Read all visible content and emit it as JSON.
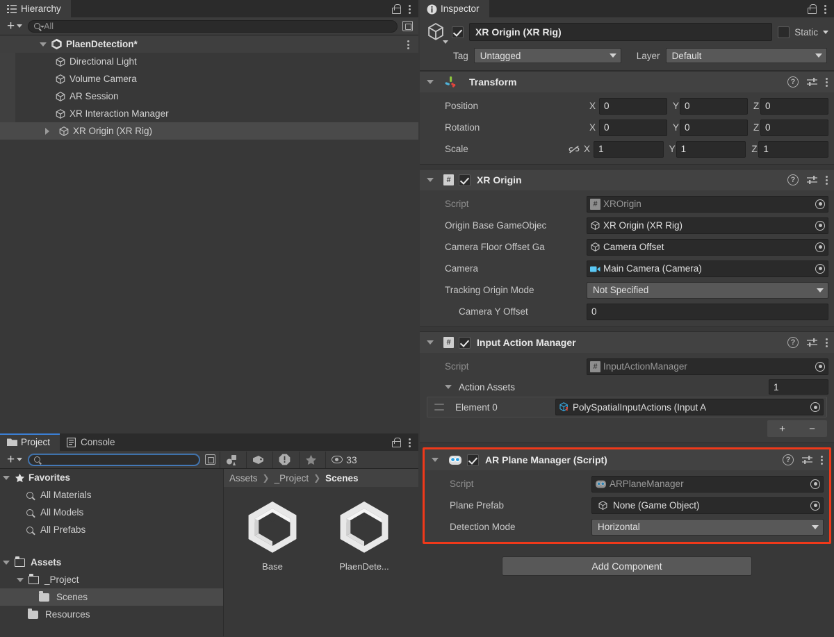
{
  "hierarchy": {
    "tab_label": "Hierarchy",
    "tab_icon": "hierarchy-icon",
    "search_placeholder": "All",
    "search_value": "",
    "scene": {
      "label": "PlaenDetection*",
      "icon": "unity-scene-icon"
    },
    "items": [
      {
        "label": "Directional Light",
        "icon": "gameobject-cube-icon",
        "selected": false,
        "expandable": false
      },
      {
        "label": "Volume Camera",
        "icon": "gameobject-cube-icon",
        "selected": false,
        "expandable": false
      },
      {
        "label": "AR Session",
        "icon": "gameobject-cube-icon",
        "selected": false,
        "expandable": false
      },
      {
        "label": "XR Interaction Manager",
        "icon": "gameobject-cube-icon",
        "selected": false,
        "expandable": false
      },
      {
        "label": "XR Origin (XR Rig)",
        "icon": "gameobject-cube-icon",
        "selected": true,
        "expandable": true
      }
    ]
  },
  "project": {
    "tabs": [
      {
        "label": "Project",
        "icon": "folder-icon",
        "active": true
      },
      {
        "label": "Console",
        "icon": "console-icon",
        "active": false
      }
    ],
    "search_value": "",
    "search_placeholder": "",
    "filter_icons": [
      "asset-type-filter-icon",
      "label-filter-icon",
      "warning-filter-icon",
      "favorite-filter-icon"
    ],
    "visible_count": "33",
    "tree": [
      {
        "label": "Favorites",
        "icon": "star-icon",
        "depth": 0,
        "expanded": true,
        "bold": true,
        "selected": false
      },
      {
        "label": "All Materials",
        "icon": "search-icon",
        "depth": 1,
        "bold": false,
        "selected": false
      },
      {
        "label": "All Models",
        "icon": "search-icon",
        "depth": 1,
        "bold": false,
        "selected": false
      },
      {
        "label": "All Prefabs",
        "icon": "search-icon",
        "depth": 1,
        "bold": false,
        "selected": false
      },
      {
        "label": "",
        "icon": "spacer",
        "depth": 0,
        "bold": false,
        "selected": false
      },
      {
        "label": "Assets",
        "icon": "folder-open-icon",
        "depth": 0,
        "expanded": true,
        "bold": true,
        "selected": false
      },
      {
        "label": "_Project",
        "icon": "folder-open-icon",
        "depth": 1,
        "expanded": true,
        "bold": false,
        "selected": false
      },
      {
        "label": "Scenes",
        "icon": "folder-icon",
        "depth": 2,
        "bold": false,
        "selected": true
      },
      {
        "label": "Resources",
        "icon": "folder-icon",
        "depth": 1,
        "bold": false,
        "selected": false
      }
    ],
    "breadcrumbs": [
      "Assets",
      "_Project",
      "Scenes"
    ],
    "assets": [
      {
        "label": "Base",
        "icon": "unity-scene-asset-icon"
      },
      {
        "label": "PlaenDete...",
        "icon": "unity-scene-asset-icon"
      }
    ]
  },
  "inspector": {
    "tab_label": "Inspector",
    "tab_icon": "info-icon",
    "object": {
      "enabled": true,
      "name": "XR Origin (XR Rig)",
      "static_label": "Static",
      "static_checked": false,
      "tag_label": "Tag",
      "tag_value": "Untagged",
      "layer_label": "Layer",
      "layer_value": "Default"
    },
    "components": [
      {
        "title": "Transform",
        "icon": "transform-axis-icon",
        "has_checkbox": false,
        "expanded": true,
        "highlight": false,
        "vectors": [
          {
            "label": "Position",
            "x": "0",
            "y": "0",
            "z": "0",
            "link": false
          },
          {
            "label": "Rotation",
            "x": "0",
            "y": "0",
            "z": "0",
            "link": false
          },
          {
            "label": "Scale",
            "x": "1",
            "y": "1",
            "z": "1",
            "link": true
          }
        ],
        "axis_labels": [
          "X",
          "Y",
          "Z"
        ]
      },
      {
        "title": "XR Origin",
        "icon": "cs-script-icon",
        "has_checkbox": true,
        "checked": true,
        "expanded": true,
        "highlight": false,
        "fields": [
          {
            "label": "Script",
            "type": "object",
            "value": "XROrigin",
            "value_icon": "cs-script-icon",
            "dim": true
          },
          {
            "label": "Origin Base GameObjec",
            "type": "object",
            "value": "XR Origin (XR Rig)",
            "value_icon": "gameobject-cube-icon",
            "dim": false
          },
          {
            "label": "Camera Floor Offset Ga",
            "type": "object",
            "value": "Camera Offset",
            "value_icon": "gameobject-cube-icon",
            "dim": false
          },
          {
            "label": "Camera",
            "type": "object",
            "value": "Main Camera (Camera)",
            "value_icon": "camera-icon",
            "dim": false
          },
          {
            "label": "Tracking Origin Mode",
            "type": "dropdown",
            "value": "Not Specified",
            "dim": false
          },
          {
            "label": "Camera Y Offset",
            "type": "number",
            "value": "0",
            "indent": true,
            "dim": false
          }
        ]
      },
      {
        "title": "Input Action Manager",
        "icon": "cs-script-icon",
        "has_checkbox": true,
        "checked": true,
        "expanded": true,
        "highlight": false,
        "fields": [
          {
            "label": "Script",
            "type": "object",
            "value": "InputActionManager",
            "value_icon": "cs-script-icon",
            "dim": true
          }
        ],
        "array": {
          "label": "Action Assets",
          "count": "1",
          "elements": [
            {
              "label": "Element 0",
              "value": "PolySpatialInputActions (Input A",
              "value_icon": "input-actions-asset-icon"
            }
          ],
          "add_label": "+",
          "remove_label": "−"
        }
      },
      {
        "title": "AR Plane Manager (Script)",
        "icon": "ar-plane-manager-icon",
        "has_checkbox": true,
        "checked": true,
        "expanded": true,
        "highlight": true,
        "highlight_color": "#f0391a",
        "fields": [
          {
            "label": "Script",
            "type": "object",
            "value": "ARPlaneManager",
            "value_icon": "ar-plane-manager-icon",
            "dim": true
          },
          {
            "label": "Plane Prefab",
            "type": "object",
            "value": "None (Game Object)",
            "value_icon": "gameobject-cube-icon",
            "dim": false
          },
          {
            "label": "Detection Mode",
            "type": "dropdown",
            "value": "Horizontal",
            "dim": false
          }
        ]
      }
    ],
    "add_component_label": "Add Component"
  },
  "colors": {
    "window_bg": "#383838",
    "tabbar_bg": "#2b2b2b",
    "panel_bg": "#3c3c3c",
    "comp_header_bg": "#424242",
    "field_bg": "#2a2a2a",
    "dropdown_bg": "#585858",
    "selection": "#4a4a4a",
    "accent_red": "#f0391a",
    "accent_blue": "#3b7fd4",
    "text": "#c4c4c4"
  }
}
